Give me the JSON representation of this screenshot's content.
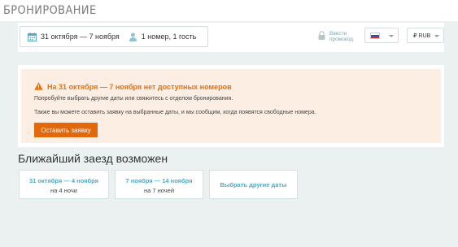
{
  "header": {
    "title": "БРОНИРОВАНИЕ"
  },
  "search": {
    "dates": "31 октября — 7 ноября",
    "guests": "1 номер, 1 гость",
    "promo_label": "Ввести промокод",
    "currency": "₽ RUB"
  },
  "alert": {
    "title": "На 31 октября — 7 ноября нет доступных номеров",
    "line1": "Попробуйте выбрать другие даты или свяжитесь с отделом бронирования.",
    "line2": "Также вы можете оставить заявку на выбранные даты, и мы сообщим, когда появятся свободные номера.",
    "button": "Оставить заявку"
  },
  "nearest": {
    "heading": "Ближайший заезд возможен",
    "options": [
      {
        "range": "31 октября — 4 ноября",
        "nights": "на 4 ночи"
      },
      {
        "range": "7 ноября — 14 ноября",
        "nights": "на 7 ночей"
      }
    ],
    "other": "Выбрать другие даты"
  },
  "colors": {
    "accent": "#e3670b",
    "alert_title": "#e8710e",
    "link": "#4fa9c2",
    "alert_bg": "#fdeee3",
    "page_bg": "#ebf0f0"
  },
  "icons": {
    "calendar": "calendar-icon",
    "guest": "person-icon",
    "promo": "lock-icon",
    "warning": "warning-icon",
    "flag": "russian-flag-icon",
    "caret": "chevron-down-icon"
  }
}
